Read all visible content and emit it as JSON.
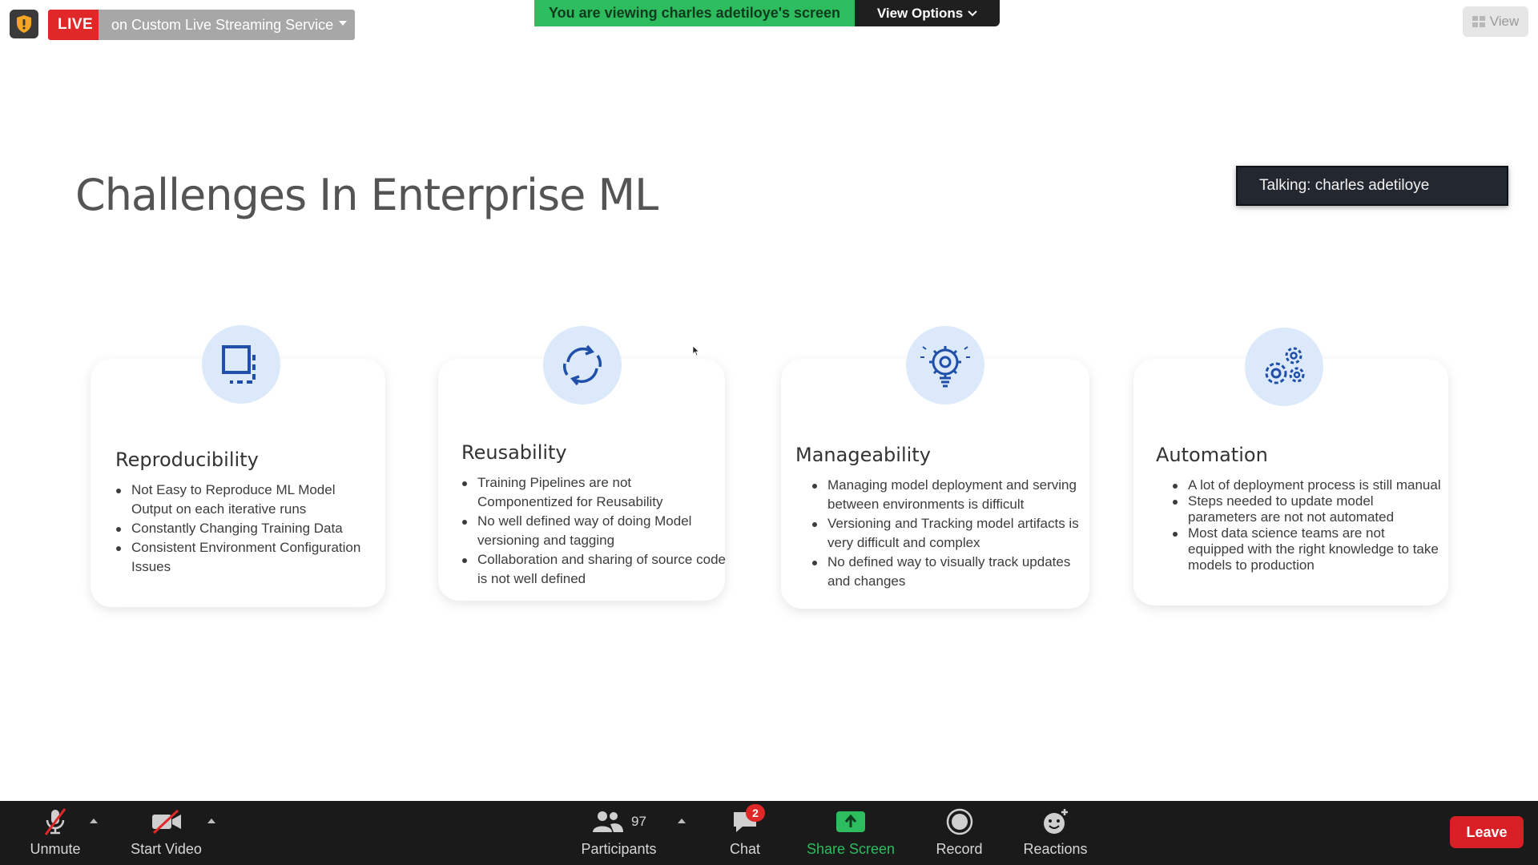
{
  "meeting": {
    "live_label": "LIVE",
    "stream_service": "on Custom Live Streaming Service",
    "viewing_text": "You are viewing charles adetiloye's screen",
    "view_options_label": "View Options",
    "view_label": "View",
    "talking_text": "Talking: charles adetiloye"
  },
  "slide": {
    "title": "Challenges In Enterprise ML",
    "cards": [
      {
        "icon": "square-dashed-icon",
        "title": "Reproducibility",
        "bullets": [
          "Not Easy to Reproduce ML Model Output on each iterative runs",
          "Constantly Changing Training Data",
          "Consistent Environment Configuration Issues"
        ]
      },
      {
        "icon": "recycle-arrows-icon",
        "title": "Reusability",
        "bullets": [
          "Training Pipelines are not Componentized for Reusability",
          "No well defined way of doing Model versioning and tagging",
          "Collaboration and sharing of source code is not well defined"
        ]
      },
      {
        "icon": "gear-lightbulb-icon",
        "title": "Manageability",
        "bullets": [
          "Managing model deployment and serving between environments is difficult",
          "Versioning and Tracking model artifacts is very difficult and complex",
          "No defined way to visually track updates and changes"
        ]
      },
      {
        "icon": "gears-icon",
        "title": "Automation",
        "bullets": [
          "A lot of deployment process is still manual",
          "Steps needed to update model parameters are not not automated",
          "Most data science teams are not equipped with the right knowledge to take models to production"
        ]
      }
    ]
  },
  "toolbar": {
    "unmute_label": "Unmute",
    "start_video_label": "Start Video",
    "participants_label": "Participants",
    "participants_count": "97",
    "chat_label": "Chat",
    "chat_badge": "2",
    "share_screen_label": "Share Screen",
    "record_label": "Record",
    "reactions_label": "Reactions",
    "leave_label": "Leave",
    "colors": {
      "share_green": "#2dbd5e",
      "leave_red": "#d91f26",
      "live_red": "#e02828"
    }
  }
}
